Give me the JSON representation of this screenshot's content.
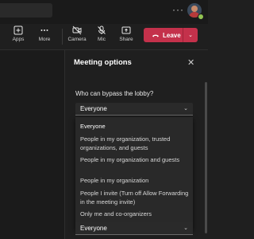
{
  "toolbar": {
    "apps": "Apps",
    "more": "More",
    "camera": "Camera",
    "mic": "Mic",
    "share": "Share",
    "leave": "Leave"
  },
  "panel": {
    "title": "Meeting options",
    "question": "Who can bypass the lobby?",
    "selected": "Everyone",
    "options": [
      "Everyone",
      "People in my organization, trusted organizations, and guests",
      "People in my organization and guests",
      "People in my organization",
      "People I invite (Turn off Allow Forwarding in the meeting invite)",
      "Only me and co-organizers"
    ],
    "next_select_value": "Everyone"
  },
  "colors": {
    "leave": "#c4314b",
    "background": "#1f1f1f",
    "presence": "#92c353"
  }
}
